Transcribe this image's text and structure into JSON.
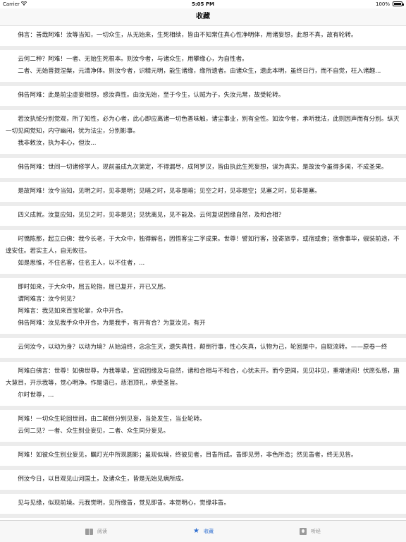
{
  "status_bar": {
    "carrier": "Carrier",
    "time": "5:05 PM",
    "battery": "100%"
  },
  "nav": {
    "title": "收藏"
  },
  "cards": [
    {
      "paragraphs": [
        "佛言：善哉阿难！汝等当知，一切众生，从无始来，生死相续，皆由不知常住真心性净明体，用诸妄想，此想不真，故有轮转。"
      ]
    },
    {
      "paragraphs": [
        "云何二种？阿难！一者、无始生死根本。则汝今者，与诸众生，用攀缘心，为自性者。",
        "二者、无始菩提涅槃，元清净体。则汝今者，识精元明，能生诸缘，缘所遗者。由诸众生，遗此本明，虽终日行，而不自觉，枉入诸趣..."
      ]
    },
    {
      "paragraphs": [
        "佛告阿难：此是前尘虚妄相想，惑汝真性。由汝无始，至于今生，认贼为子，失汝元常，故受轮转。"
      ]
    },
    {
      "paragraphs": [
        "若汝执恡分别觉观，所了知性，必为心者，此心即应离诸一切色香味触，诸尘事业，别有全性。如汝今者，承听我法，此则因声而有分别。纵灭一切见闻觉知，内守幽闲，犹为法尘，分别影事。",
        "我非敕汝，执为非心，但汝..."
      ]
    },
    {
      "paragraphs": [
        "佛告阿难：世间一切诸修学人，现前虽成九次第定，不得漏尽，成阿罗汉，皆由执此生死妄想，误为真实。是故汝今虽得多闻，不成圣果。"
      ]
    },
    {
      "paragraphs": [
        "是故阿难！汝今当知，见明之时，见非是明；见暗之时，见非是暗；见空之时，见非是空；见塞之时，见非是塞。"
      ]
    },
    {
      "paragraphs": [
        "四义成就。汝复应知，见见之时，见非是见；见犹离见，见不能及。云何复说因缘自然，及和合相？"
      ]
    },
    {
      "paragraphs": [
        "时憍陈那，起立白佛：我今长老，于大众中，独得解名，因悟客尘二字成果。世尊！譬如行客，投寄旅亭，或宿或食；宿食事毕，俶装前途，不遑安住。若实主人，自无攸往。",
        "如是思惟，不住名客，住名主人，以不住者，..."
      ]
    },
    {
      "paragraphs": [
        "即时如来，于大众中，屈五轮指，屈已复开，开已又屈。",
        "谓阿难言：汝今何见？",
        "阿难言：我见如来百宝轮掌，众中开合。",
        "佛告阿难：汝见我手众中开合，为是我手，有开有合？为复汝见，有开"
      ]
    },
    {
      "paragraphs": [
        "云何汝今，以动为身？以动为境？从始洎终，念念生灭，遗失真性，颠倒行事，性心失真，认物为己，轮回是中，自取流转。——原卷一终"
      ]
    },
    {
      "paragraphs": [
        "阿难白佛言：世尊！如佛世尊，为我等辈，宣说因缘及与自然，诸和合相与不和合，心犹未开。而今更闻，见见非见，重增迷闷！伏愿弘慈，施大慧目，开示我等，觉心明净。作是语已，悲泪顶礼，承受圣旨。",
        "尔时世尊，..."
      ]
    },
    {
      "paragraphs": [
        "阿难！一切众生轮回世间，由二颠倒分别见妄，当处发生，当业轮转。",
        "云何二见？一者、众生别业妄见，二者、众生同分妄见。"
      ]
    },
    {
      "paragraphs": [
        "阿难！如彼众生别业妄见，瞩灯光中所现圆影；虽现似境，终彼见者，目眚所成。眚即见劳，非色所造；然见眚者，终无见咎。"
      ]
    },
    {
      "paragraphs": [
        "例汝今日，以目观见山河国土，及诸众生，皆是无始见病所成。"
      ]
    },
    {
      "paragraphs": [
        "见与见缘，似现前境。元我觉明，见所缘眚，觉见即眚。本觉明心，觉缘非眚。"
      ]
    }
  ],
  "tabs": [
    {
      "label": "阅读",
      "icon": "book-icon",
      "active": false
    },
    {
      "label": "收藏",
      "icon": "star-icon",
      "active": true
    },
    {
      "label": "听经",
      "icon": "listen-icon",
      "active": false
    }
  ],
  "colors": {
    "accent": "#2f6fd0",
    "separator": "#ececec",
    "inactive_tab": "#8e8e8e"
  }
}
